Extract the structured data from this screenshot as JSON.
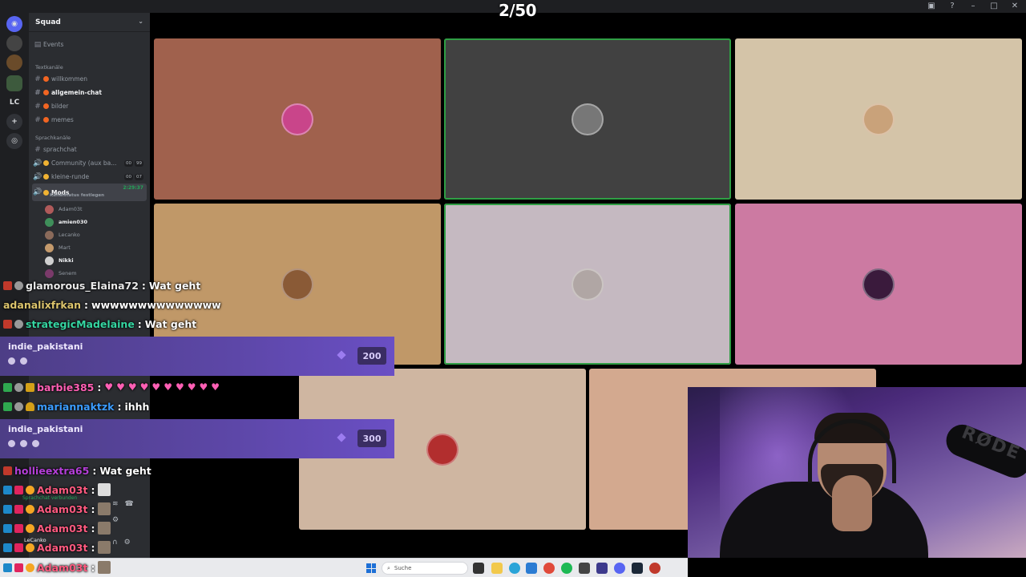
{
  "viewer_counter": "2/50",
  "server": {
    "name": "Squad",
    "events_label": "Events",
    "text_category": "Textkanäle",
    "text_channels": [
      {
        "name": "willkommen",
        "active": false,
        "color": "#f26522"
      },
      {
        "name": "allgemein-chat",
        "active": true,
        "color": "#f26522"
      },
      {
        "name": "bilder",
        "active": false,
        "color": "#f26522"
      },
      {
        "name": "memes",
        "active": false,
        "color": "#f26522"
      }
    ],
    "voice_category": "Sprachkanäle",
    "voice_channels": [
      {
        "name": "sprachchat",
        "badges": []
      },
      {
        "name": "Community (aux ba...",
        "badges": [
          "00",
          "99"
        ],
        "color": "#f0b232"
      },
      {
        "name": "kleine-runde",
        "badges": [
          "00",
          "07"
        ],
        "color": "#f0b232"
      },
      {
        "name": "Mods",
        "time": "2:29:37",
        "status": "Kanalstatus festlegen",
        "color": "#f0b232"
      }
    ],
    "members": [
      "Adam03t",
      "amien030",
      "Lecanko",
      "Mart",
      "Nikki",
      "Senem"
    ],
    "rail_label": "LC"
  },
  "tiles": [
    {
      "bg": "#a0614d",
      "avatar": "#c9458a",
      "speaking": false
    },
    {
      "bg": "#414141",
      "avatar": "#777",
      "speaking": true
    },
    {
      "bg": "#d4c4a8",
      "avatar": "#c9a27a",
      "speaking": false
    },
    {
      "bg": "#c09868",
      "avatar": "#8a5a36",
      "speaking": false
    },
    {
      "bg": "#c5b9c1",
      "avatar": "#b0a6a4",
      "speaking": true
    },
    {
      "bg": "#cc7aa2",
      "avatar": "#3a1a3c",
      "speaking": false
    },
    {
      "bg": "#cfb6a1",
      "avatar": "#b22e2e",
      "speaking": false
    },
    {
      "bg": "#d3a98f",
      "avatar": "",
      "speaking": false
    }
  ],
  "chat": [
    {
      "user": "glamorous_Elaina72",
      "color": "#e9e9e9",
      "msg": "Wat geht"
    },
    {
      "user": "adanalixfrkan",
      "color": "#dcc46c",
      "msg": "wwwwwwwwwwwwww"
    },
    {
      "user": "strategicMadelaine",
      "color": "#35d6a2",
      "msg": "Wat geht"
    },
    {
      "user": "barbie385",
      "color": "#ff5fb4",
      "msg": "hearts"
    },
    {
      "user": "mariannaktzk",
      "color": "#3b9cff",
      "msg": "ihhh"
    },
    {
      "user": "hollieextra65",
      "color": "#b43fd8",
      "msg": "Wat geht"
    },
    {
      "user": "Adam03t",
      "color": "#ff5a80",
      "msg": ""
    },
    {
      "user": "Adam03t",
      "color": "#ff5a80",
      "msg": ""
    },
    {
      "user": "Adam03t",
      "color": "#ff5a80",
      "msg": ""
    },
    {
      "user": "Adam03t",
      "color": "#ff5a80",
      "msg": ""
    },
    {
      "user": "Adam03t",
      "color": "#ff5a80",
      "msg": ""
    }
  ],
  "hype_chats": [
    {
      "user": "indie_pakistani",
      "amount": "200"
    },
    {
      "user": "indie_pakistani",
      "amount": "300"
    }
  ],
  "voice_panel": {
    "status": "Sprachchat verbunden",
    "user": "LeCanko"
  },
  "taskbar": {
    "search_placeholder": "Suche"
  },
  "webcam": {
    "mic_brand": "RØDE"
  }
}
